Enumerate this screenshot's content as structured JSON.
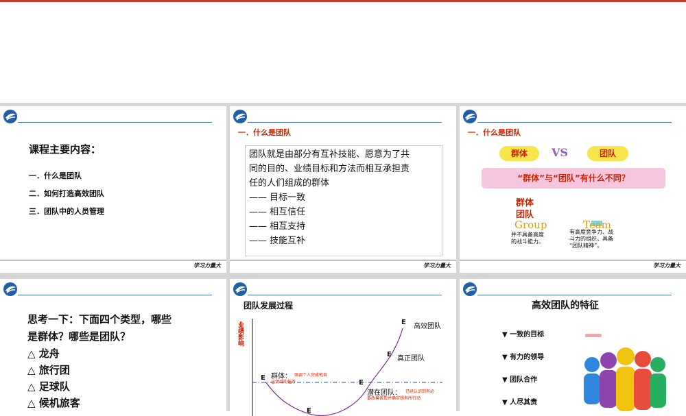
{
  "footer_text": "学习力量大",
  "slide1": {
    "heading": "课程主要内容：",
    "items": [
      "一．什么是团队",
      "二．如何打造高效团队",
      "三．团队中的人员管理"
    ]
  },
  "slide2": {
    "title": "一．什么是团队",
    "definition_lines": [
      "团队就是由部分有互补技能、愿意为了共",
      "同的目的、业绩目标和方法而相互承担责",
      "任的人们组成的群体"
    ],
    "points": [
      "—— 目标一致",
      "—— 相互信任",
      "—— 相互支持",
      "—— 技能互补"
    ]
  },
  "slide3": {
    "title": "一．什么是团队",
    "group_badge": "群体",
    "vs": "VS",
    "team_badge": "团队",
    "question": "“群体”与“团队”有什么不同？",
    "group_label_1": "群体",
    "group_label_2": "团队",
    "group_en": "Group",
    "team_en": "Team",
    "group_desc": [
      "并不具备高度",
      "的战斗能力。"
    ],
    "team_desc": [
      "有高度竞争力、战",
      "斗力的组织，具备",
      "“团队精神”。"
    ]
  },
  "slide4": {
    "question_lines": [
      "思考一下：下面四个类型，哪些",
      "是群体？哪些是团队？"
    ],
    "options": [
      "△  龙舟",
      "△  旅行团",
      "△  足球队",
      "△  候机旅客"
    ]
  },
  "slide5": {
    "title": "团队发展过程",
    "ylabel": "业绩影响",
    "labels": {
      "high_team": "高效团队",
      "real_team": "真正团队",
      "group": "群体：",
      "group_desc_1": "强调个人完成他自",
      "group_desc_2": "己领域的任务",
      "potential": "潜在团队：",
      "potential_desc_1": "已经认识到有必",
      "potential_desc_2": "要改善表现并确实想有所行动"
    },
    "point_marker": "E"
  },
  "slide6": {
    "title": "高效团队的特征",
    "features": [
      "▼ 一致的目标",
      "▼ 有力的领导",
      "▼ 团队合作",
      "▼ 人尽其责"
    ]
  },
  "colors": {
    "accent_red": "#cc2200",
    "badge_yellow": "#f7e64b",
    "question_pink": "#f6c6de",
    "line_blue": "#3a6fb0"
  }
}
